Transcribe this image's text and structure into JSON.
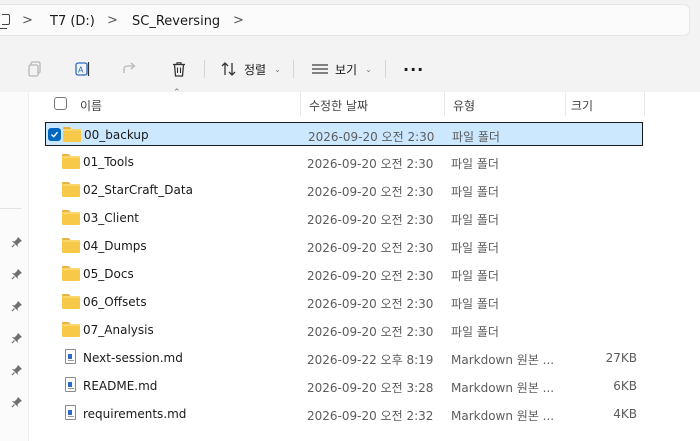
{
  "breadcrumb": {
    "items": [
      "T7 (D:)",
      "SC_Reversing"
    ],
    "separator": ">"
  },
  "toolbar": {
    "sort_label": "정렬",
    "view_label": "보기",
    "more_label": "···"
  },
  "icons": {
    "copy": "copy-icon",
    "rename": "rename-icon",
    "share": "share-icon",
    "delete": "trash-icon",
    "sort": "sort-icon",
    "view": "view-icon"
  },
  "columns": {
    "name": "이름",
    "date": "수정한 날짜",
    "type": "유형",
    "size": "크기"
  },
  "files": [
    {
      "name": "00_backup",
      "date": "2026-09-20 오전 2:30",
      "type": "파일 폴더",
      "size": "",
      "kind": "folder",
      "selected": true
    },
    {
      "name": "01_Tools",
      "date": "2026-09-20 오전 2:30",
      "type": "파일 폴더",
      "size": "",
      "kind": "folder"
    },
    {
      "name": "02_StarCraft_Data",
      "date": "2026-09-20 오전 2:30",
      "type": "파일 폴더",
      "size": "",
      "kind": "folder"
    },
    {
      "name": "03_Client",
      "date": "2026-09-20 오전 2:30",
      "type": "파일 폴더",
      "size": "",
      "kind": "folder"
    },
    {
      "name": "04_Dumps",
      "date": "2026-09-20 오전 2:30",
      "type": "파일 폴더",
      "size": "",
      "kind": "folder"
    },
    {
      "name": "05_Docs",
      "date": "2026-09-20 오전 2:30",
      "type": "파일 폴더",
      "size": "",
      "kind": "folder"
    },
    {
      "name": "06_Offsets",
      "date": "2026-09-20 오전 2:30",
      "type": "파일 폴더",
      "size": "",
      "kind": "folder"
    },
    {
      "name": "07_Analysis",
      "date": "2026-09-20 오전 2:30",
      "type": "파일 폴더",
      "size": "",
      "kind": "folder"
    },
    {
      "name": "Next-session.md",
      "date": "2026-09-22 오후 8:19",
      "type": "Markdown 원본 ...",
      "size": "27KB",
      "kind": "file"
    },
    {
      "name": "README.md",
      "date": "2026-09-20 오전 3:28",
      "type": "Markdown 원본 ...",
      "size": "6KB",
      "kind": "file"
    },
    {
      "name": "requirements.md",
      "date": "2026-09-20 오전 2:32",
      "type": "Markdown 원본 ...",
      "size": "4KB",
      "kind": "file"
    }
  ],
  "colors": {
    "accent": "#0067c0",
    "selection": "#cce8ff",
    "folder": "#f8c949"
  }
}
